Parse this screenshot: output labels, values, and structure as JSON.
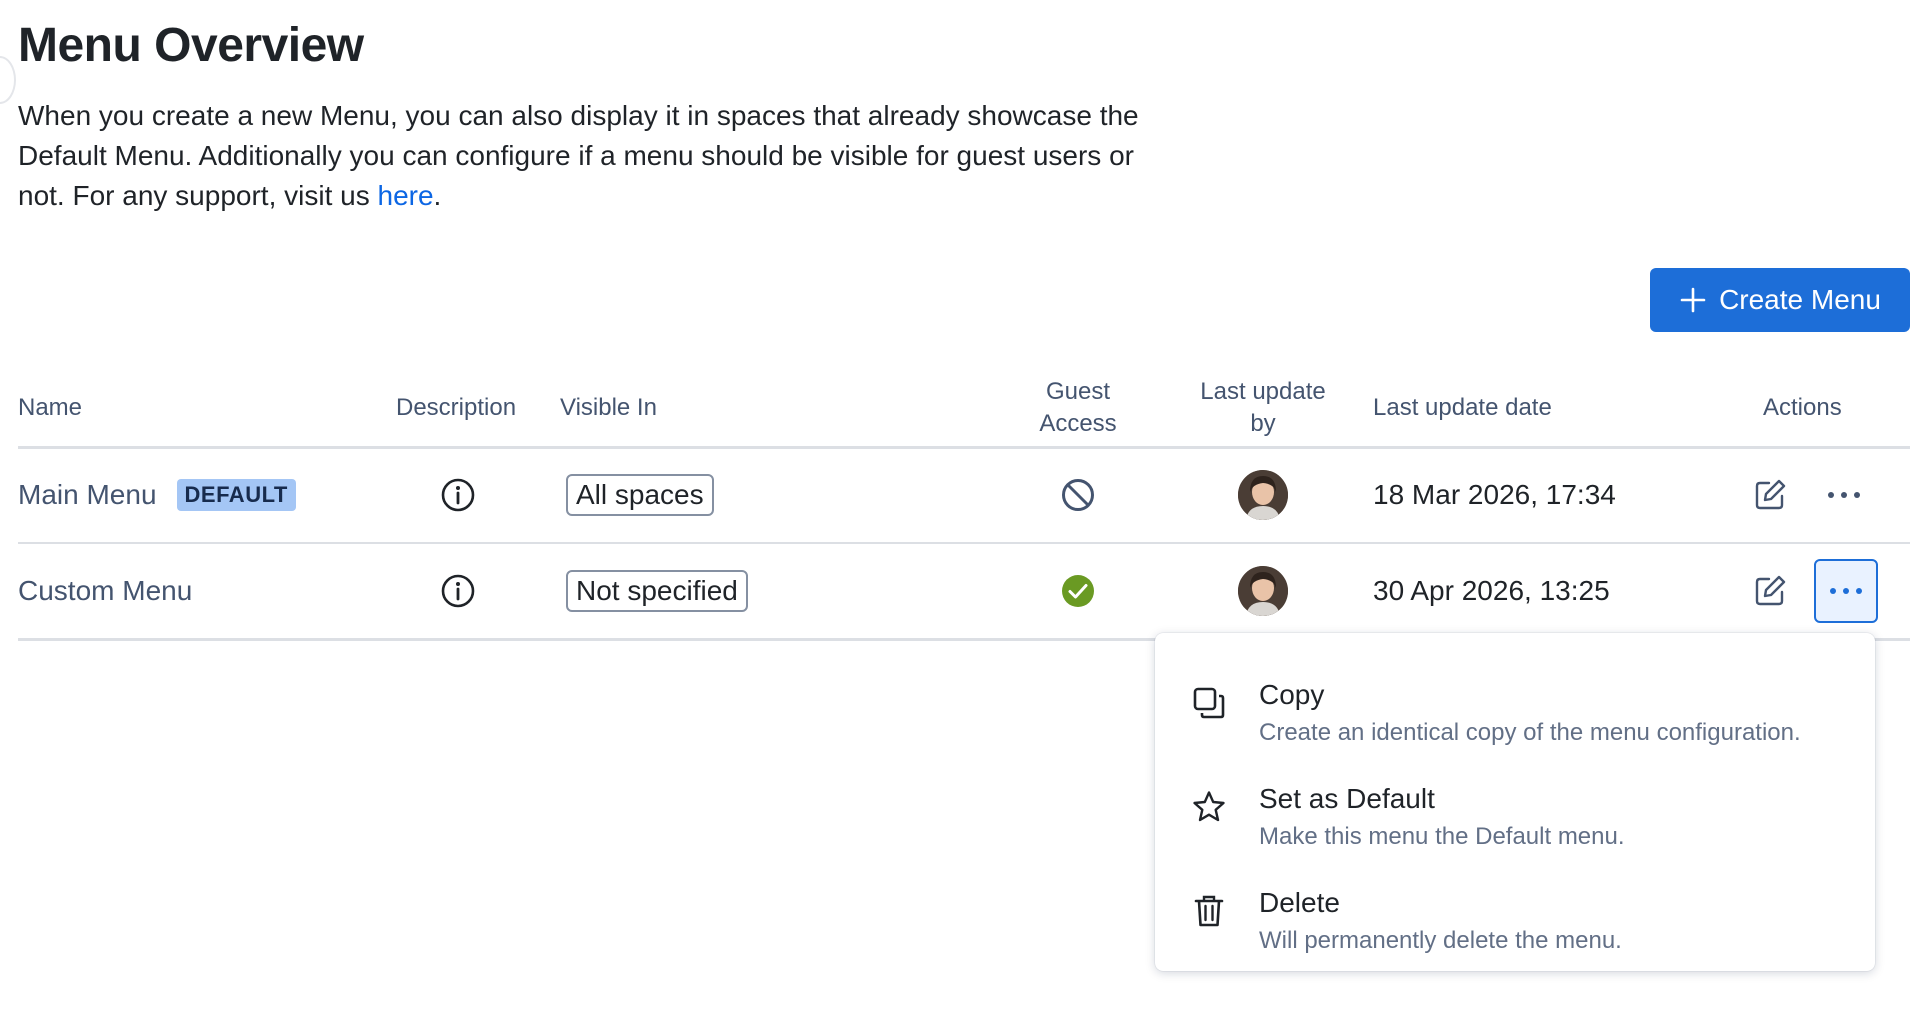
{
  "page": {
    "title": "Menu Overview",
    "intro_text": "When you create a new Menu, you can also display it in spaces that already showcase the Default Menu. Additionally you can configure if a menu should be visible for guest users or not. For any support, visit us ",
    "intro_link": "here",
    "intro_end": "."
  },
  "toolbar": {
    "create_label": "Create Menu"
  },
  "table": {
    "headers": {
      "name": "Name",
      "description": "Description",
      "visible_in": "Visible In",
      "guest_access_line1": "Guest",
      "guest_access_line2": "Access",
      "last_update_by_line1": "Last update",
      "last_update_by_line2": "by",
      "last_update_date": "Last update date",
      "actions": "Actions"
    },
    "rows": [
      {
        "name": "Main Menu",
        "badge": "DEFAULT",
        "visible_in": "All spaces",
        "guest_access": "blocked",
        "last_update_date": "18 Mar 2026, 17:34"
      },
      {
        "name": "Custom Menu",
        "badge": "",
        "visible_in": "Not specified",
        "guest_access": "allowed",
        "last_update_date": "30 Apr 2026, 13:25"
      }
    ]
  },
  "dropdown": {
    "items": [
      {
        "icon": "copy-icon",
        "title": "Copy",
        "description": "Create an identical copy of the menu configuration."
      },
      {
        "icon": "star-icon",
        "title": "Set as Default",
        "description": "Make this menu the Default menu."
      },
      {
        "icon": "trash-icon",
        "title": "Delete",
        "description": "Will permanently delete the menu."
      }
    ]
  },
  "colors": {
    "primary": "#1d6ed8",
    "badge": "#a4c6f5",
    "success": "#6a9a23",
    "link": "#0c66e4"
  }
}
